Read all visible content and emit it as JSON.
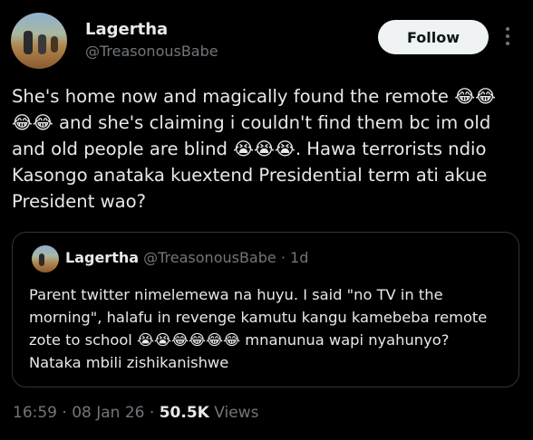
{
  "author": {
    "name": "Lagertha",
    "handle": "@TreasonousBabe"
  },
  "follow_label": "Follow",
  "more_icon": "more-vertical-icon",
  "tweet": {
    "text": "She's home now and magically found the remote 😂😂\n😂😂 and she's claiming i couldn't find them bc im old\nand old people are blind 😭😭😭. Hawa terrorists ndio\nKasongo anataka kuextend Presidential term ati akue\nPresident wao?"
  },
  "quote": {
    "name": "Lagertha",
    "handle": "@TreasonousBabe",
    "separator": "·",
    "time": "1d",
    "text": "Parent twitter nimelemewa na huyu. I said \"no TV in the\nmorning\", halafu in revenge kamutu kangu kamebeba remote\nzote to school 😭😭😂😂😂😂 mnanunua wapi nyahunyo?\nNataka mbili zishikanishwe"
  },
  "meta": {
    "time": "16:59",
    "date": "08 Jan 26",
    "views_count": "50.5K",
    "views_label": "Views",
    "separator": "·"
  }
}
